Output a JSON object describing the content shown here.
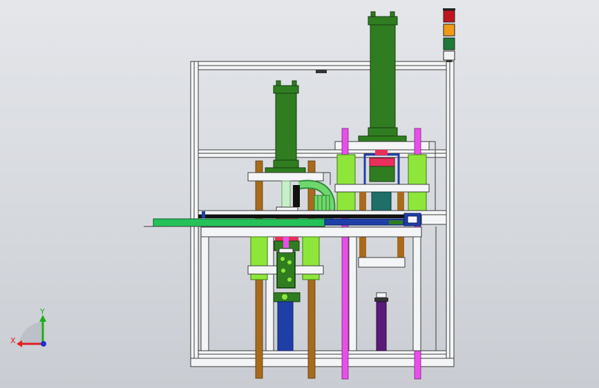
{
  "viewport": {
    "axes": {
      "x_label": "X",
      "y_label": "Y"
    }
  },
  "colors": {
    "frame_fill": "#f4f5f7",
    "frame_stroke": "#3a3a3a",
    "green_dark": "#2f7d20",
    "green_light": "#8ee63a",
    "green_conveyor": "#25c25a",
    "brown": "#a86a1c",
    "magenta": "#e84fe8",
    "blue": "#1f3fa8",
    "purple": "#5b1a7a",
    "teal": "#1f6e68",
    "red": "#e8305a",
    "tower_red": "#c0141c",
    "tower_orange": "#f09a18",
    "tower_green": "#1e7a3a",
    "tower_white": "#f2f2f2",
    "axis_red": "#e02020",
    "axis_green": "#18b018",
    "axis_blue": "#2030d0"
  },
  "icons": {
    "signal_tower": "signal-tower-icon",
    "triad": "coordinate-triad-icon"
  }
}
